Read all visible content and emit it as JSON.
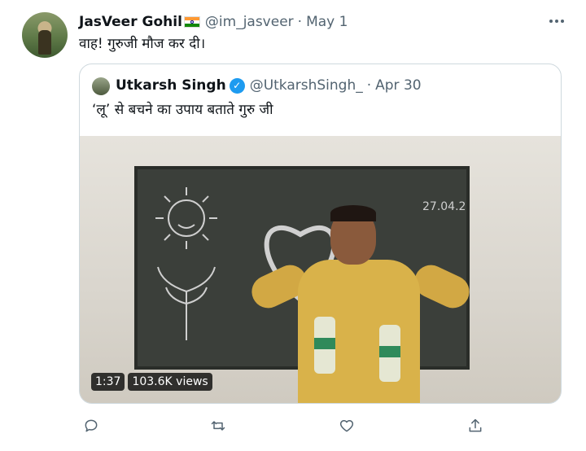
{
  "tweet": {
    "display_name": "JasVeer Gohil",
    "handle": "@im_jasveer",
    "separator": "·",
    "date": "May 1",
    "text": "वाह! गुरुजी मौज कर दी।"
  },
  "quoted_tweet": {
    "display_name": "Utkarsh Singh",
    "verified_mark": "✓",
    "handle": "@UtkarshSingh_",
    "separator": "·",
    "date": "Apr 30",
    "text": "‘लू’ से बचने का उपाय बताते गुरु जी",
    "video": {
      "duration": "1:37",
      "views": "103.6K views"
    }
  },
  "actions": {
    "reply_icon": "reply-icon",
    "retweet_icon": "retweet-icon",
    "like_icon": "like-icon",
    "share_icon": "share-icon"
  },
  "colors": {
    "text_primary": "#0f1419",
    "text_secondary": "#536471",
    "verified_blue": "#1d9bf0",
    "border": "#cfd9de"
  }
}
